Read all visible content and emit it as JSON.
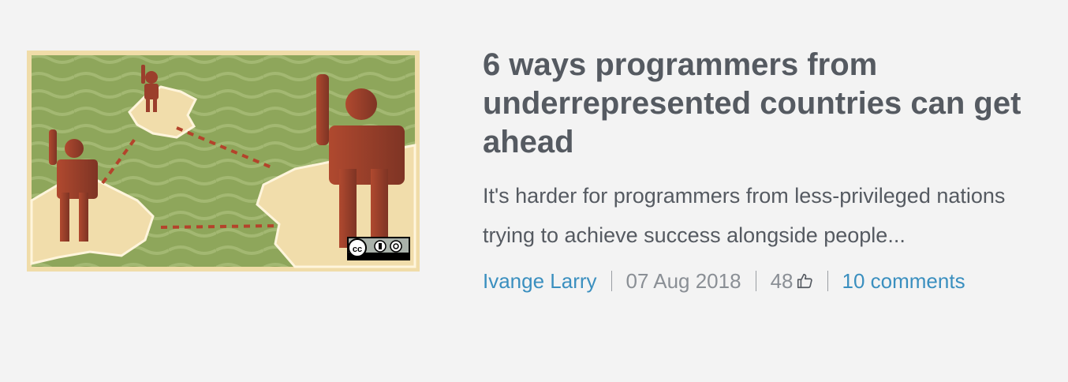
{
  "article": {
    "title": "6 ways programmers from underrepresented countries can get ahead",
    "teaser": "It's harder for programmers from less-privileged nations trying to achieve success alongside people...",
    "author": "Ivange Larry",
    "date": "07 Aug 2018",
    "likes": "48",
    "comments": "10 comments",
    "image": {
      "description_icon": "map-figures-illustration",
      "license_badge": "cc-by-sa-badge"
    }
  },
  "colors": {
    "background": "#f3f3f3",
    "title": "#555a61",
    "link": "#3a8fbf",
    "meta_muted": "#8a8f95",
    "image_green": "#8fa55c",
    "image_sand": "#f1ddaa",
    "figure_red": "#9b3f2c"
  }
}
